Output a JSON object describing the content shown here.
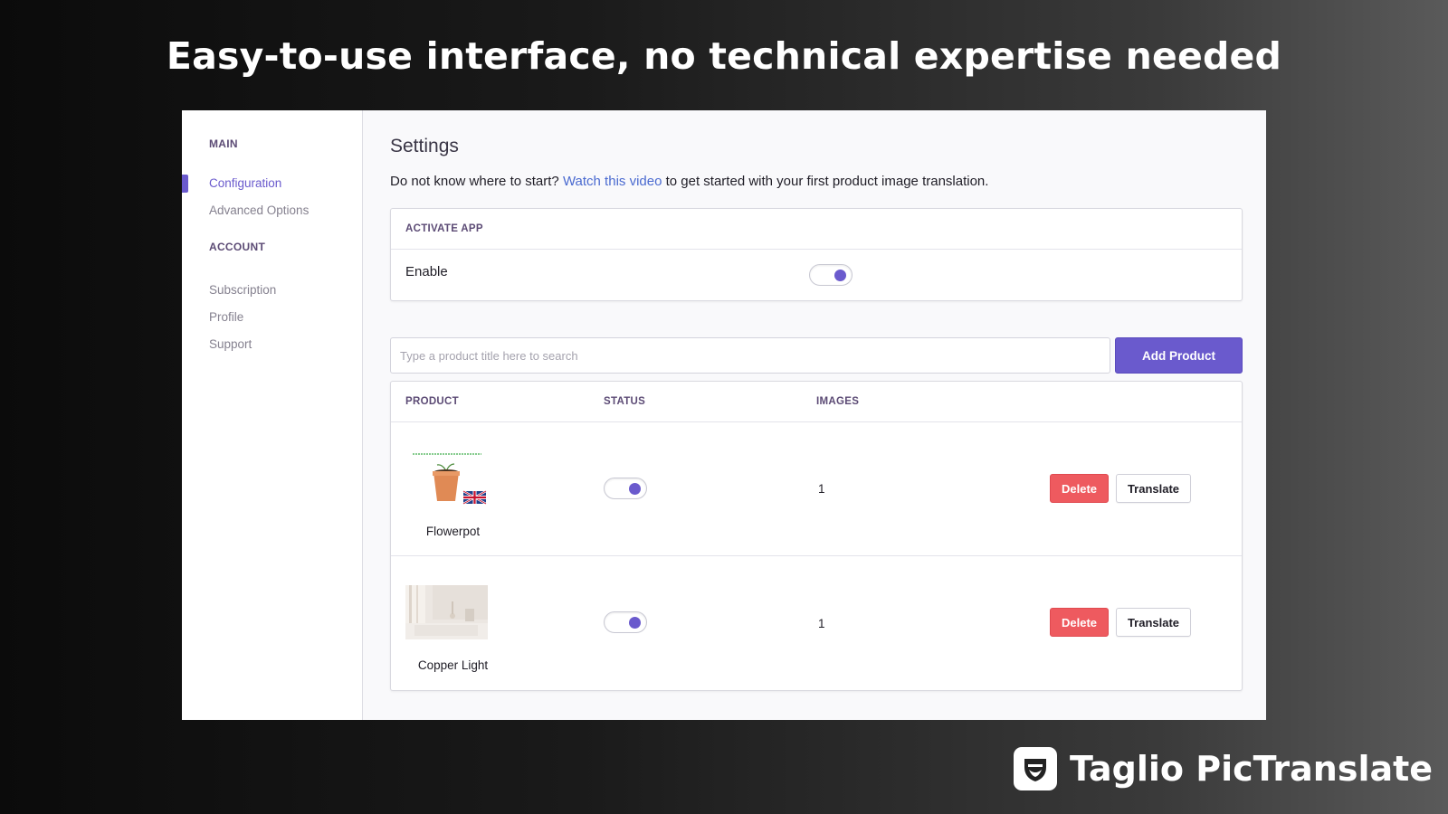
{
  "headline": "Easy-to-use interface, no technical expertise needed",
  "sidebar": {
    "sections": [
      {
        "title": "MAIN",
        "items": [
          {
            "label": "Configuration",
            "active": true
          },
          {
            "label": "Advanced Options",
            "active": false
          }
        ]
      },
      {
        "title": "ACCOUNT",
        "items": [
          {
            "label": "Subscription",
            "active": false
          },
          {
            "label": "Profile",
            "active": false
          },
          {
            "label": "Support",
            "active": false
          }
        ]
      }
    ]
  },
  "main": {
    "title": "Settings",
    "intro_before": "Do not know where to start? ",
    "intro_link": "Watch this video",
    "intro_after": " to get started with your first product image translation.",
    "activate": {
      "header": "ACTIVATE APP",
      "enable_label": "Enable",
      "enabled": true
    },
    "search": {
      "placeholder": "Type a product title here to search",
      "value": ""
    },
    "add_button": "Add Product",
    "table": {
      "columns": [
        "PRODUCT",
        "STATUS",
        "IMAGES"
      ],
      "rows": [
        {
          "name": "Flowerpot",
          "status_on": true,
          "images": "1",
          "delete": "Delete",
          "translate": "Translate",
          "thumb": "flowerpot-image"
        },
        {
          "name": "Copper Light",
          "status_on": true,
          "images": "1",
          "delete": "Delete",
          "translate": "Translate",
          "thumb": "copper-light-image"
        }
      ]
    }
  },
  "brand": {
    "name": "Taglio PicTranslate"
  },
  "colors": {
    "accent": "#6a5acd",
    "danger": "#ee5a5f",
    "section": "#5c4b75",
    "link": "#4a6ad0"
  }
}
